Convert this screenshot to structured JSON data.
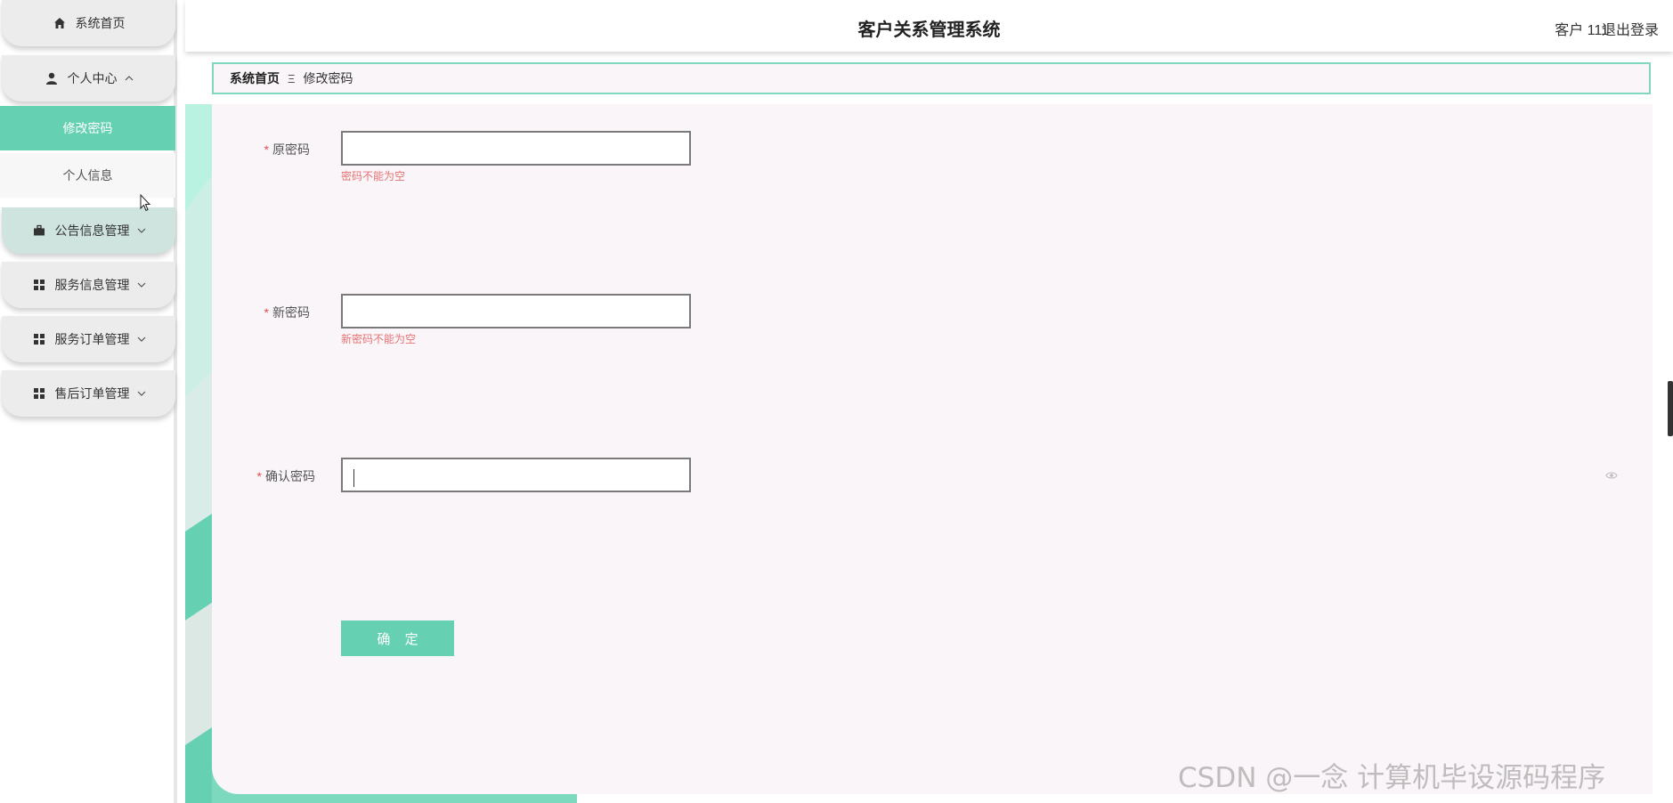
{
  "sidebar": {
    "home": {
      "label": "系统首页",
      "icon": "home-icon"
    },
    "personal_center": {
      "label": "个人中心",
      "icon": "user-icon",
      "expanded": true
    },
    "sub_items": [
      {
        "label": "修改密码",
        "active": true
      },
      {
        "label": "个人信息",
        "active": false
      }
    ],
    "groups": [
      {
        "label": "公告信息管理",
        "icon": "briefcase-icon"
      },
      {
        "label": "服务信息管理",
        "icon": "grid-icon"
      },
      {
        "label": "服务订单管理",
        "icon": "grid-icon"
      },
      {
        "label": "售后订单管理",
        "icon": "grid-icon"
      }
    ]
  },
  "header": {
    "title": "客户关系管理系统",
    "user": "客户 111",
    "logout": "退出登录"
  },
  "breadcrumb": {
    "home": "系统首页",
    "separator": "Ξ",
    "current": "修改密码"
  },
  "form": {
    "old_password": {
      "label": "原密码",
      "value": "",
      "error": "密码不能为空"
    },
    "new_password": {
      "label": "新密码",
      "value": "",
      "error": "新密码不能为空"
    },
    "confirm_password": {
      "label": "确认密码",
      "value": ""
    },
    "required_mark": "*",
    "submit_label": "确 定"
  },
  "watermark": "CSDN @一念 计算机毕设源码程序",
  "colors": {
    "accent": "#66d1b2",
    "error": "#e57373",
    "card_bg": "#f9f5f8"
  }
}
